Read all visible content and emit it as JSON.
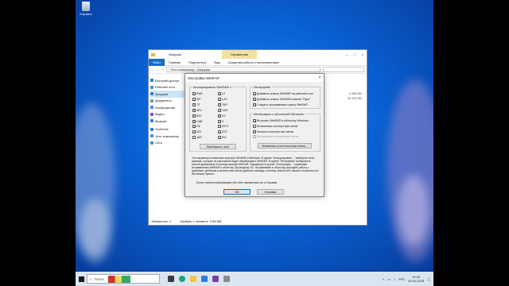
{
  "desktop": {
    "recycle_bin_label": "Корзина"
  },
  "explorer": {
    "title": "Загрузки",
    "context_tab": "Управление",
    "ribbon_tabs": [
      "Файл",
      "Главная",
      "Поделиться",
      "Вид",
      "Средства работы с приложениями"
    ],
    "breadcrumb": "› Этот компьютер › Загрузки",
    "nav_items": [
      {
        "label": "Быстрый доступ",
        "icon": "star-icon",
        "color": "#2b7fd9"
      },
      {
        "label": "Рабочий стол",
        "icon": "folder-icon",
        "color": "#3c8fe0"
      },
      {
        "label": "Загрузки",
        "icon": "download-icon",
        "color": "#2b7fd9"
      },
      {
        "label": "Документы",
        "icon": "document-icon",
        "color": "#7d8fa3"
      },
      {
        "label": "Изображения",
        "icon": "picture-icon",
        "color": "#3c8fe0"
      },
      {
        "label": "Видео",
        "icon": "video-icon",
        "color": "#7b4fb8"
      },
      {
        "label": "Музыка",
        "icon": "music-icon",
        "color": "#2b7fd9"
      },
      {
        "label": "OneDrive",
        "icon": "cloud-icon",
        "color": "#2b7fd9"
      },
      {
        "label": "Этот компьютер",
        "icon": "computer-icon",
        "color": "#3c8fe0"
      },
      {
        "label": "Сеть",
        "icon": "network-icon",
        "color": "#3c8fe0"
      }
    ],
    "column_values": [
      "4 962 КБ",
      "23 902 КБ"
    ],
    "status_count": "Элементов: 2",
    "status_selected": "Выбран 1 элемент: 3,98 МБ"
  },
  "dialog": {
    "title": "Настройка WinRAR",
    "close_glyph": "×",
    "assoc_group": "Ассоциировать WinRAR с",
    "assoc_left": [
      {
        "label": "RAR",
        "checked": true
      },
      {
        "label": "ZIP",
        "checked": true
      },
      {
        "label": "7Z",
        "checked": true
      },
      {
        "label": "ARJ",
        "checked": true
      },
      {
        "label": "BZ2",
        "checked": true
      },
      {
        "label": "CAB",
        "checked": true
      },
      {
        "label": "GZ",
        "checked": true
      },
      {
        "label": "ISO",
        "checked": true
      },
      {
        "label": "JAR",
        "checked": false
      }
    ],
    "assoc_right": [
      {
        "label": "LZ",
        "checked": true
      },
      {
        "label": "LZH",
        "checked": true
      },
      {
        "label": "TAR",
        "checked": true
      },
      {
        "label": "UUE",
        "checked": true
      },
      {
        "label": "XZ",
        "checked": true
      },
      {
        "label": "Z",
        "checked": true
      },
      {
        "label": "ZIPX",
        "checked": true
      },
      {
        "label": "ZST",
        "checked": true
      },
      {
        "label": "001",
        "checked": true
      }
    ],
    "toggle_all_button": "Все/Никого: все",
    "interface_group": "Интерфейс",
    "interface_items": [
      {
        "label": "Добавить значок WinRAR на рабочий стол",
        "checked": true
      },
      {
        "label": "Добавить значок WinRAR в меню \"Пуск\"",
        "checked": true
      },
      {
        "label": "Создать программную группу WinRAR",
        "checked": true
      }
    ],
    "shell_group": "Интеграция с оболочкой Windows",
    "shell_items": [
      {
        "label": "Встроить WinRAR в оболочку Windows",
        "checked": true,
        "disabled": false
      },
      {
        "label": "Вложенные контекстные меню",
        "checked": false,
        "disabled": false
      },
      {
        "label": "Значки в контекстных меню",
        "checked": true,
        "disabled": false
      },
      {
        "label": "Устаревшие контекстные меню",
        "checked": false,
        "disabled": true
      }
    ],
    "context_items_button": "Элементы в контекстном меню...",
    "description": "Эти параметры позволяют встроить WinRAR в Windows. В группе \"Ассоциировать...\" выберите типы архивов, которые по умолчанию будет обрабатывать WinRAR. В группе \"Интерфейс\" выбирается способ добавления в систему вызова WinRAR. Параметры в группе \"Интеграция...\" управляют встраиванием WinRAR в оболочку (Проводник) ОС. Встраивание в оболочку упрощает работу с архивами, добавляя в контекстные меню удобные команды, поэтому обычно нет смысла отключать его без веских причин.",
    "more_info": "Более полную информацию обо всех параметрах см. в Справке.",
    "ok_button": "ОК",
    "help_button": "Справка"
  },
  "taskbar": {
    "search_placeholder": "Поиск",
    "language": "РУС",
    "time": "19:23",
    "date": "29.01.2025"
  }
}
